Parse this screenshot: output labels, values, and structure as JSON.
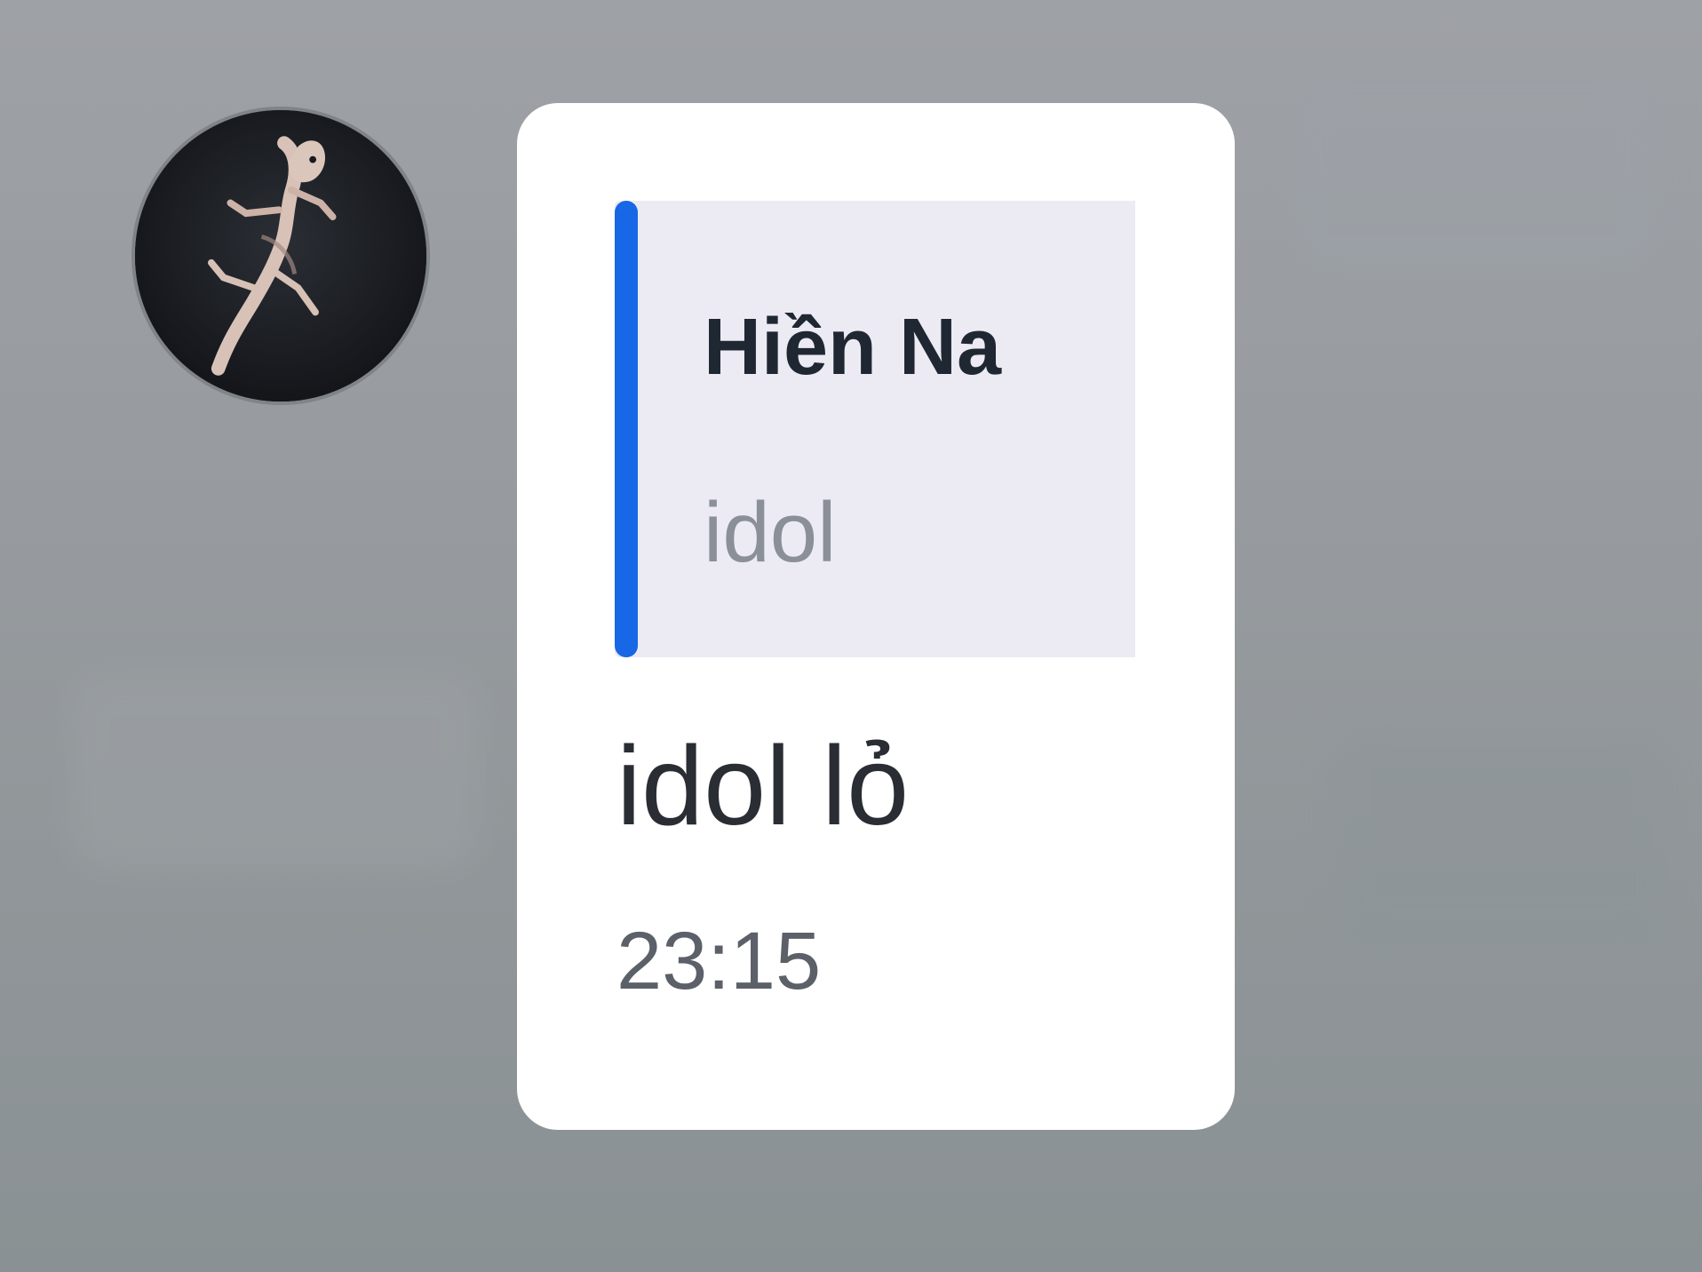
{
  "conversation": {
    "message": {
      "sender_avatar_icon": "gecko-avatar-icon",
      "reply": {
        "name": "Hiền Na",
        "text": "idol"
      },
      "text": "idol lỏ",
      "time": "23:15"
    }
  },
  "colors": {
    "bubble": "#ffffff",
    "quote_background": "#ecebf4",
    "quote_accent": "#1767e6",
    "text_primary": "#2a2d33",
    "text_muted": "#8b8f97",
    "timestamp": "#5b6069"
  }
}
